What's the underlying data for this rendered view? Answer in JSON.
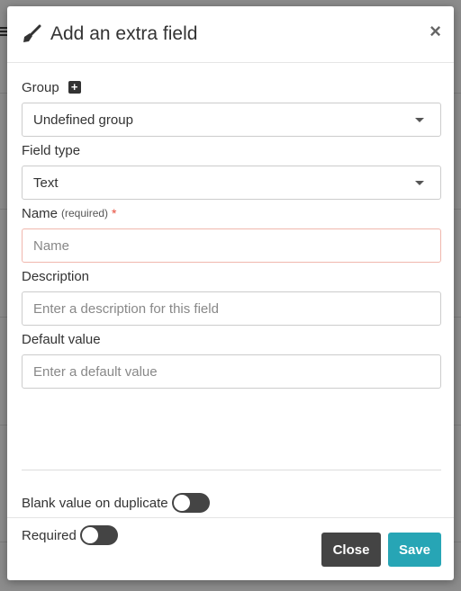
{
  "modal": {
    "title": "Add an extra field",
    "close_glyph": "×",
    "title_icon": "brush-icon"
  },
  "group": {
    "label": "Group",
    "add_icon": "plus-square-icon",
    "selected": "Undefined group"
  },
  "field_type": {
    "label": "Field type",
    "selected": "Text"
  },
  "name": {
    "label": "Name",
    "hint": "(required)",
    "required_mark": "*",
    "placeholder": "Name"
  },
  "description": {
    "label": "Description",
    "placeholder": "Enter a description for this field"
  },
  "default_value": {
    "label": "Default value",
    "placeholder": "Enter a default value"
  },
  "toggles": {
    "blank_on_duplicate": {
      "label": "Blank value on duplicate",
      "on": false
    },
    "required": {
      "label": "Required",
      "on": false
    }
  },
  "footer": {
    "close_label": "Close",
    "save_label": "Save"
  },
  "colors": {
    "save_button": "#27a5b5",
    "close_button": "#444444",
    "required_star": "#e74c3c"
  }
}
